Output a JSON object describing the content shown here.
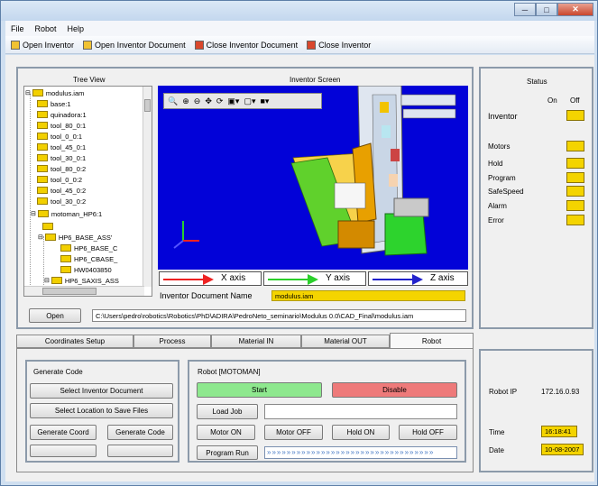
{
  "menu": {
    "file": "File",
    "robot": "Robot",
    "help": "Help"
  },
  "toolbar": {
    "open_inventor": "Open Inventor",
    "open_doc": "Open Inventor Document",
    "close_doc": "Close Inventor Document",
    "close_inventor": "Close Inventor"
  },
  "tree": {
    "title": "Tree View",
    "nodes": [
      "modulus.iam",
      "base:1",
      "quinadora:1",
      "tool_80_0:1",
      "tool_0_0:1",
      "tool_45_0:1",
      "tool_30_0:1",
      "tool_80_0:2",
      "tool_0_0:2",
      "tool_45_0:2",
      "tool_30_0:2",
      "motoman_HP6:1",
      "",
      "HP6_BASE_ASS'",
      "HP6_BASE_C",
      "HP6_CBASE_",
      "HW0403850",
      "HP6_SAXIS_ASS"
    ]
  },
  "inventor_screen": {
    "title": "Inventor Screen",
    "x_axis": "X axis",
    "y_axis": "Y axis",
    "z_axis": "Z axis",
    "doc_name_label": "Inventor Document Name",
    "doc_name_value": "modulus.iam"
  },
  "open": {
    "button": "Open",
    "path": "C:\\Users\\pedro\\robotics\\Robotics\\PhD\\ADIRA\\PedroNeto_seminario\\Modulus 0.0\\CAD_Final\\modulus.iam"
  },
  "status": {
    "title": "Status",
    "on": "On",
    "off": "Off",
    "inventor": "Inventor",
    "motors": "Motors",
    "hold": "Hold",
    "program": "Program",
    "safespeed": "SafeSpeed",
    "alarm": "Alarm",
    "error": "Error"
  },
  "tabs": [
    "Coordinates Setup",
    "Process",
    "Material IN",
    "Material OUT",
    "Robot"
  ],
  "generate": {
    "title": "Generate Code",
    "select_doc": "Select Inventor Document",
    "select_location": "Select Location to Save Files",
    "gen_coord": "Generate Coord",
    "gen_code": "Generate Code"
  },
  "robot_panel": {
    "title": "Robot [MOTOMAN]",
    "start": "Start",
    "disable": "Disable",
    "load_job": "Load Job",
    "motor_on": "Motor ON",
    "motor_off": "Motor OFF",
    "hold_on": "Hold ON",
    "hold_off": "Hold OFF",
    "program_run": "Program Run"
  },
  "info": {
    "robot_ip_label": "Robot IP",
    "robot_ip": "172.16.0.93",
    "time_label": "Time",
    "time": "16:18:41",
    "date_label": "Date",
    "date": "10-08-2007"
  },
  "colors": {
    "indicator": "#f4d400",
    "start": "#8ee88e",
    "disable": "#ee7a7a",
    "viewport": "#0202d8"
  }
}
